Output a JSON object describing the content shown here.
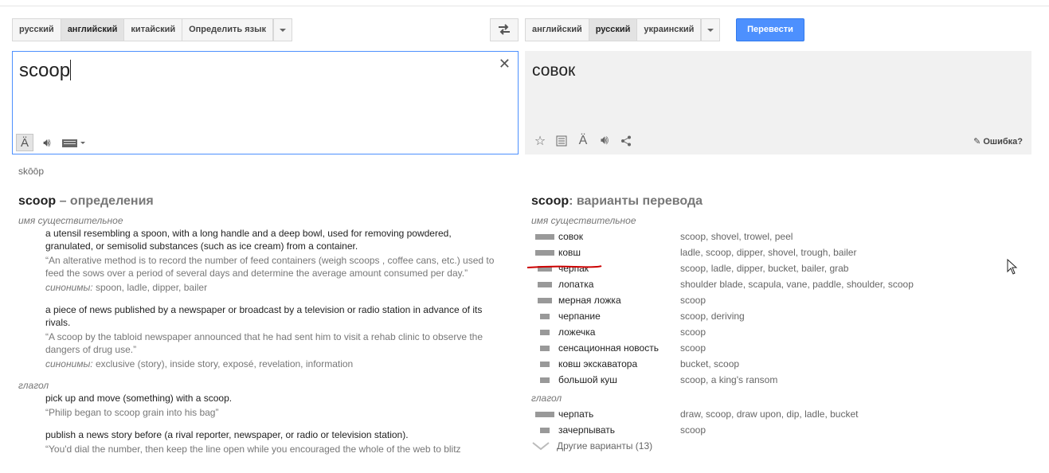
{
  "source_langs": [
    "русский",
    "английский",
    "китайский",
    "Определить язык"
  ],
  "source_active": 1,
  "target_langs": [
    "английский",
    "русский",
    "украинский"
  ],
  "target_active": 1,
  "translate_label": "Перевести",
  "source_text": "scoop",
  "target_text": "совок",
  "report_label": "Ошибка?",
  "phonetic": "skōōp",
  "definitions": {
    "word": "scoop",
    "title_suffix": " – определения",
    "noun_label": "имя существительное",
    "verb_label": "глагол",
    "noun": [
      {
        "gloss": "a utensil resembling a spoon, with a long handle and a deep bowl, used for removing powdered, granulated, or semisolid substances (such as ice cream) from a container.",
        "example": "“An alterative method is to record the number of feed containers (weigh scoops , coffee cans, etc.) used to feed the sows over a period of several days and determine the average amount consumed per day.”",
        "syn_label": "синонимы:",
        "synonyms": "spoon, ladle, dipper, bailer"
      },
      {
        "gloss": "a piece of news published by a newspaper or broadcast by a television or radio station in advance of its rivals.",
        "example": "“A scoop by the tabloid newspaper announced that he had sent him to visit a rehab clinic to observe the dangers of drug use.”",
        "syn_label": "синонимы:",
        "synonyms": "exclusive (story), inside story, exposé, revelation, information"
      }
    ],
    "verb": [
      {
        "gloss": "pick up and move (something) with a scoop.",
        "example": "“Philip began to scoop grain into his bag”"
      },
      {
        "gloss": "publish a news story before (a rival reporter, newspaper, or radio or television station).",
        "example": "“You'd dial the number, then keep the line open while you encouraged the whole of the web to blitz"
      }
    ]
  },
  "translations": {
    "word": "scoop",
    "title_suffix": ": варианты перевода",
    "noun_label": "имя существительное",
    "verb_label": "глагол",
    "noun_rows": [
      {
        "word": "совок",
        "syn": "scoop, shovel, trowel, peel",
        "freq": 1.0
      },
      {
        "word": "ковш",
        "syn": "ladle, scoop, dipper, shovel, trough, bailer",
        "freq": 1.0
      },
      {
        "word": "черпак",
        "syn": "scoop, ladle, dipper, bucket, bailer, grab",
        "freq": 0.67
      },
      {
        "word": "лопатка",
        "syn": "shoulder blade, scapula, vane, paddle, shoulder, scoop",
        "freq": 0.67
      },
      {
        "word": "мерная ложка",
        "syn": "scoop",
        "freq": 0.67
      },
      {
        "word": "черпание",
        "syn": "scoop, deriving",
        "freq": 0.33
      },
      {
        "word": "ложечка",
        "syn": "scoop",
        "freq": 0.33
      },
      {
        "word": "сенсационная новость",
        "syn": "scoop",
        "freq": 0.33
      },
      {
        "word": "ковш экскаватора",
        "syn": "bucket, scoop",
        "freq": 0.33
      },
      {
        "word": "большой куш",
        "syn": "scoop, a king's ransom",
        "freq": 0.33
      }
    ],
    "verb_rows": [
      {
        "word": "черпать",
        "syn": "draw, scoop, draw upon, dip, ladle, bucket",
        "freq": 1.0
      },
      {
        "word": "зачерпывать",
        "syn": "scoop",
        "freq": 0.33
      }
    ],
    "more_label": "Другие варианты (13)"
  },
  "colors": {
    "accent": "#4d90fe",
    "underline": "#cc0000"
  }
}
